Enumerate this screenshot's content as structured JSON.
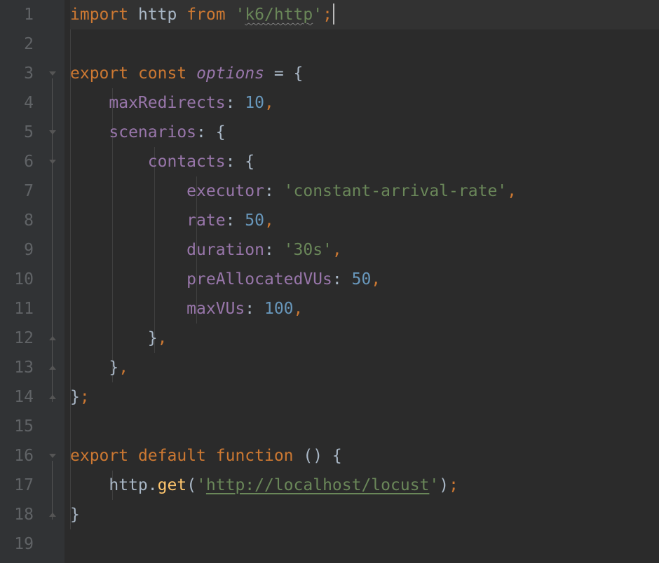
{
  "lineNumbers": [
    "1",
    "2",
    "3",
    "4",
    "5",
    "6",
    "7",
    "8",
    "9",
    "10",
    "11",
    "12",
    "13",
    "14",
    "15",
    "16",
    "17",
    "18",
    "19"
  ],
  "code": {
    "l1": {
      "kw_import": "import",
      "http": "http",
      "kw_from": "from",
      "q1": "'",
      "mod": "k6/http",
      "q2": "'",
      "semi": ";"
    },
    "l3": {
      "kw_export": "export",
      "kw_const": "const",
      "options": "options",
      "eq": " = ",
      "brace": "{"
    },
    "l4": {
      "key": "maxRedirects",
      "colon": ": ",
      "val": "10",
      "comma": ","
    },
    "l5": {
      "key": "scenarios",
      "colon": ": ",
      "brace": "{"
    },
    "l6": {
      "key": "contacts",
      "colon": ": ",
      "brace": "{"
    },
    "l7": {
      "key": "executor",
      "colon": ": ",
      "val": "'constant-arrival-rate'",
      "comma": ","
    },
    "l8": {
      "key": "rate",
      "colon": ": ",
      "val": "50",
      "comma": ","
    },
    "l9": {
      "key": "duration",
      "colon": ": ",
      "val": "'30s'",
      "comma": ","
    },
    "l10": {
      "key": "preAllocatedVUs",
      "colon": ": ",
      "val": "50",
      "comma": ","
    },
    "l11": {
      "key": "maxVUs",
      "colon": ": ",
      "val": "100",
      "comma": ","
    },
    "l12": {
      "brace": "}",
      "comma": ","
    },
    "l13": {
      "brace": "}",
      "comma": ","
    },
    "l14": {
      "brace": "}",
      "semi": ";"
    },
    "l16": {
      "kw_export": "export",
      "kw_default": "default",
      "kw_function": "function",
      "parens": " ()",
      "brace": " {"
    },
    "l17": {
      "obj": "http",
      "dot": ".",
      "method": "get",
      "open": "(",
      "q1": "'",
      "url": "http://localhost/locust",
      "q2": "'",
      "close": ")",
      "semi": ";"
    },
    "l18": {
      "brace": "}"
    }
  },
  "fold": {
    "open_lines": [
      3,
      5,
      6,
      16
    ],
    "close_lines": [
      12,
      13,
      14,
      18
    ]
  }
}
